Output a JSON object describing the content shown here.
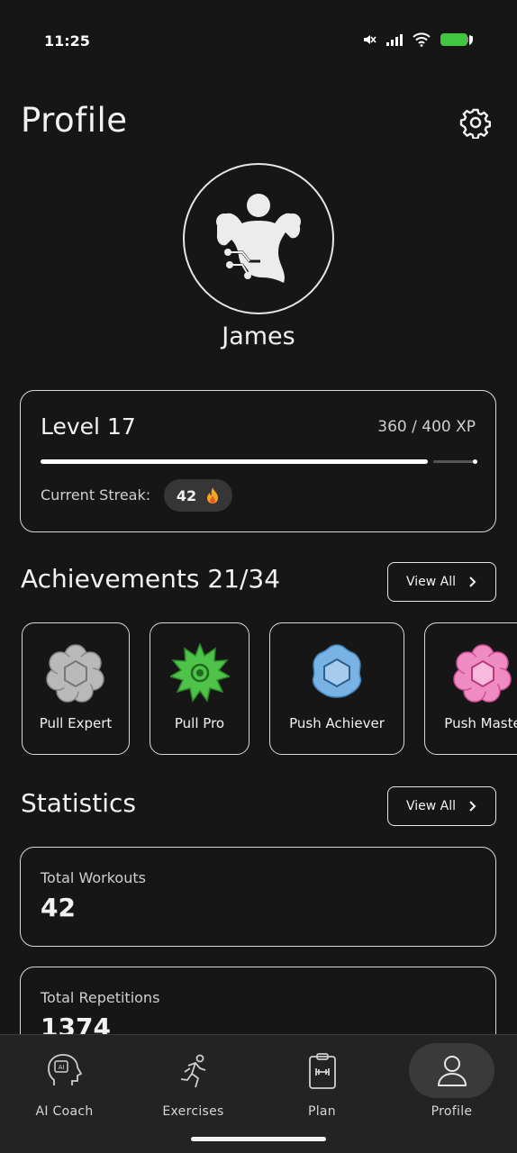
{
  "status_bar": {
    "time": "11:25"
  },
  "header": {
    "title": "Profile"
  },
  "profile": {
    "name": "James"
  },
  "level": {
    "title": "Level 17",
    "xp_text": "360 / 400 XP",
    "xp_progress": 0.9,
    "streak_label": "Current Streak:",
    "streak_value": "42"
  },
  "achievements": {
    "title": "Achievements 21/34",
    "view_all": "View All",
    "items": [
      {
        "label": "Pull Expert",
        "color": "#b9b9b9"
      },
      {
        "label": "Pull Pro",
        "color": "#4fc24a"
      },
      {
        "label": "Push Achiever",
        "color": "#79b3e3"
      },
      {
        "label": "Push Maste",
        "color": "#f08cc4"
      }
    ]
  },
  "statistics": {
    "title": "Statistics",
    "view_all": "View All",
    "items": [
      {
        "label": "Total Workouts",
        "value": "42"
      },
      {
        "label": "Total Repetitions",
        "value": "1374"
      }
    ]
  },
  "tabs": [
    {
      "label": "AI Coach",
      "icon": "ai-coach-icon"
    },
    {
      "label": "Exercises",
      "icon": "running-icon"
    },
    {
      "label": "Plan",
      "icon": "plan-clipboard-icon"
    },
    {
      "label": "Profile",
      "icon": "user-icon",
      "active": true
    }
  ]
}
